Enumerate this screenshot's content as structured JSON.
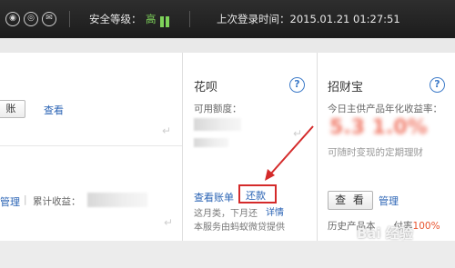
{
  "topbar": {
    "user_icon": "user-icon",
    "shield_icon": "shield-icon",
    "mail_icon": "mail-icon",
    "security_label": "安全等级：",
    "security_level": "高",
    "last_login": "上次登录时间：2015.01.21 01:27:51"
  },
  "left": {
    "account_button": "账",
    "view_link": "查看",
    "manage_link": "管理",
    "separator": "|",
    "cumulative_label": "累计收益："
  },
  "huabei": {
    "title": "花呗",
    "limit_label": "可用额度：",
    "bill_link": "查看账单",
    "repay_link": "还款",
    "due_text": "这月类，下月还",
    "detail_link": "详情",
    "provider_text": "本服务由蚂蚁微贷提供"
  },
  "zhaocaibao": {
    "title": "招财宝",
    "rate_label": "今日主供产品年化收益率：",
    "rate_desc": "可随时变现的定期理财",
    "view_button": "查 看",
    "manage_link": "管理",
    "history_label": "历史产品本",
    "history_suffix": "付率",
    "history_pct": "100%"
  },
  "watermark": "Bai 经验",
  "colors": {
    "topbar_bg": "#1c1c1c",
    "level_green": "#7ed35a",
    "link_blue": "#2a63b4",
    "highlight_red": "#d42a2a"
  }
}
